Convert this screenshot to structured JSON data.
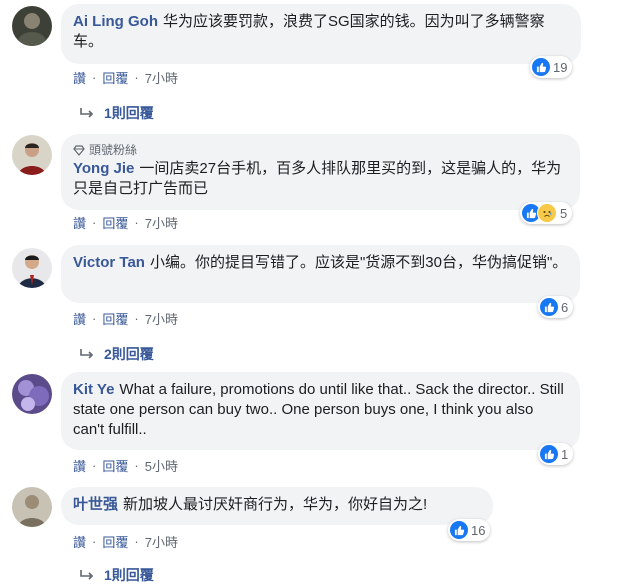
{
  "action_labels": {
    "like": "讚",
    "reply": "回覆"
  },
  "comments": [
    {
      "author": "Ai Ling Goh",
      "text": "华为应该要罚款，浪费了SG国家的钱。因为叫了多辆警察车。",
      "time": "7小時",
      "reactions": "19",
      "replies": "1則回覆"
    },
    {
      "author": "Yong Jie",
      "badge": "頭號粉絲",
      "text": "一间店卖27台手机，百多人排队那里买的到，这是骗人的，华为只是自己打广告而已",
      "time": "7小時",
      "reactions": "5"
    },
    {
      "author": "Victor Tan",
      "text": "小编。你的提目写错了。应该是\"货源不到30台，华伪搞促销\"。",
      "time": "7小時",
      "reactions": "6",
      "replies": "2則回覆"
    },
    {
      "author": "Kit Ye",
      "text": "What a failure, promotions do until like that.. Sack the director.. Still state one person can buy two.. One person buys one, I think you also can't fulfill..",
      "time": "5小時",
      "reactions": "1"
    },
    {
      "author": "叶世强",
      "text": "新加坡人最讨厌奸商行为，华为，你好自为之!",
      "time": "7小時",
      "reactions": "16",
      "replies": "1則回覆"
    }
  ],
  "colors": {
    "author": "#385898",
    "bubble": "#f2f3f5",
    "like_blue": "#1877f2",
    "meta": "#606770"
  }
}
